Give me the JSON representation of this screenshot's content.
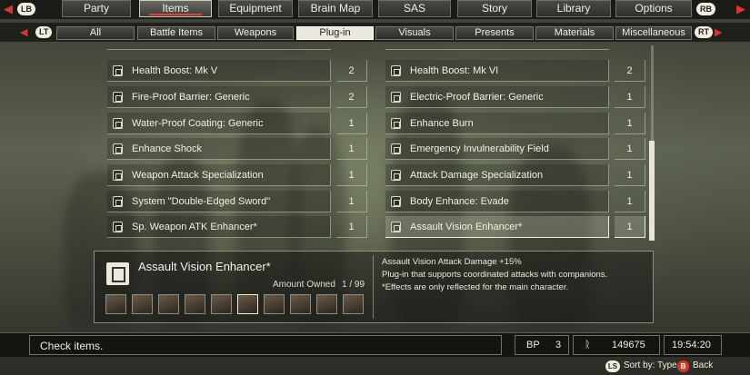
{
  "top_menu": {
    "left_bumper": "LB",
    "right_bumper": "RB",
    "tabs": [
      {
        "label": "Party"
      },
      {
        "label": "Items"
      },
      {
        "label": "Equipment"
      },
      {
        "label": "Brain Map"
      },
      {
        "label": "SAS"
      },
      {
        "label": "Story"
      },
      {
        "label": "Library"
      },
      {
        "label": "Options"
      }
    ],
    "active_tab": "Items"
  },
  "sub_menu": {
    "left_trigger": "LT",
    "right_trigger": "RT",
    "tabs": [
      {
        "label": "All"
      },
      {
        "label": "Battle Items"
      },
      {
        "label": "Weapons"
      },
      {
        "label": "Plug-in"
      },
      {
        "label": "Visuals"
      },
      {
        "label": "Presents"
      },
      {
        "label": "Materials"
      },
      {
        "label": "Miscellaneous"
      }
    ],
    "active_tab": "Plug-in"
  },
  "items_left": [
    {
      "name": "Health Boost: Mk V",
      "qty": "2"
    },
    {
      "name": "Fire-Proof Barrier: Generic",
      "qty": "2"
    },
    {
      "name": "Water-Proof Coating: Generic",
      "qty": "1"
    },
    {
      "name": "Enhance Shock",
      "qty": "1"
    },
    {
      "name": "Weapon Attack Specialization",
      "qty": "1"
    },
    {
      "name": "System \"Double-Edged Sword\"",
      "qty": "1"
    },
    {
      "name": "Sp. Weapon ATK Enhancer*",
      "qty": "1"
    }
  ],
  "items_right": [
    {
      "name": "Health Boost: Mk VI",
      "qty": "2"
    },
    {
      "name": "Electric-Proof Barrier: Generic",
      "qty": "1"
    },
    {
      "name": "Enhance Burn",
      "qty": "1"
    },
    {
      "name": "Emergency Invulnerability Field",
      "qty": "1"
    },
    {
      "name": "Attack Damage Specialization",
      "qty": "1"
    },
    {
      "name": "Body Enhance: Evade",
      "qty": "1"
    },
    {
      "name": "Assault Vision Enhancer*",
      "qty": "1"
    }
  ],
  "selected_item": "Assault Vision Enhancer*",
  "detail": {
    "name": "Assault Vision Enhancer*",
    "amount_owned_label": "Amount Owned",
    "amount_owned_value": "1 / 99",
    "description_lines": [
      "Assault Vision Attack Damage +15%",
      "Plug-in that supports coordinated attacks with companions.",
      "*Effects are only reflected for the main character."
    ],
    "party_member_count": 10
  },
  "status_bar": {
    "help_text": "Check items.",
    "bp_label": "BP",
    "bp_value": "3",
    "currency_symbol": "ᚱ",
    "currency_value": "149675",
    "clock": "19:54:20"
  },
  "button_hints": {
    "sort_button": "LS",
    "sort_label": "Sort by: Type",
    "back_button": "B",
    "back_label": "Back"
  },
  "colors": {
    "accent_red": "#d33a2c",
    "active_tab_bg": "#ebe8dd",
    "text": "#f2efe6"
  },
  "icons": {
    "plugin_item": "plugin-chip-icon",
    "nav_left": "triangle-left-icon",
    "nav_right": "triangle-right-icon"
  }
}
